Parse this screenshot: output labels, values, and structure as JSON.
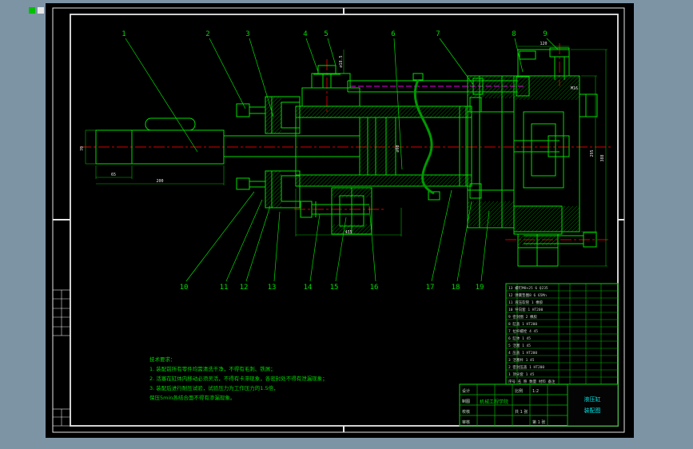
{
  "palette": {
    "viewer_background": "#7d94a5",
    "sheet_background": "#000000",
    "line_green": "#00dc00",
    "line_dark_green": "#009900",
    "centerline_red": "#d40000",
    "phantom_magenta": "#e000e0",
    "frame_white": "#e6e6e6",
    "title_cyan": "#00e0e0"
  },
  "callouts": {
    "top": [
      "1",
      "2",
      "3",
      "4",
      "5",
      "6",
      "7",
      "8",
      "9"
    ],
    "bottom": [
      "10",
      "11",
      "12",
      "13",
      "14",
      "15",
      "16",
      "17",
      "18",
      "19"
    ]
  },
  "dims": {
    "shaft_dia": "70",
    "shaft_len_a": "65",
    "shaft_len_b": "200",
    "cyl_len": "435",
    "flange_h": "295",
    "cap_h": "388",
    "bolt_dia": "∅18.5",
    "bore_dia": "∅90",
    "thread": "M16",
    "cap_w": "120"
  },
  "notes": {
    "title": "技术要求：",
    "lines": [
      "1. 装配前所有零件均需清洗干净，不得有毛刺、铁屑；",
      "2. 活塞在缸体内移动必须灵活，不得有卡滞现象，各密封处不得有泄漏现象；",
      "3. 装配后进行耐压试验，试验压力为工作压力的1.5倍，",
      "   保压5min各结合面不得有渗漏现象。"
    ]
  },
  "bom": {
    "rows": [
      "13  螺钉M8×25    6   Q235",
      "12  弹簧垫圈8     6   65Mn",
      "11  液压软管      1   橡胶",
      "10  导向套        1   HT200",
      "9   密封圈        2   橡胶",
      "8   缸盖          1   HT200",
      "7   拉杆螺栓      4   45",
      "6   缸体          1   45",
      "5   活塞          1   45",
      "4   压盖          1   HT200",
      "3   活塞杆        1   45",
      "2   密封压盖      1   HT200",
      "1   顶尖套        1   45"
    ],
    "header": "序号  名  称     数量  材料  备注"
  },
  "title_block": {
    "signatures": [
      "设计",
      "制图",
      "校核",
      "审核"
    ],
    "scale_label": "比例",
    "scale_value": "1:2",
    "sheet_label": "共 1 张",
    "sheet_value": "第 1 张",
    "school": "机械工程学院",
    "drawing_title_line1": "液压缸",
    "drawing_title_line2": "装配图"
  }
}
